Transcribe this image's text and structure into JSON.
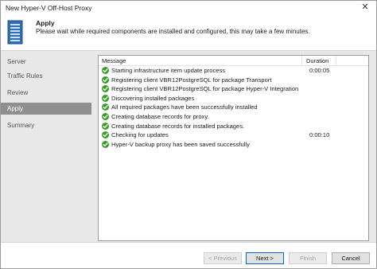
{
  "window": {
    "title": "New Hyper-V Off-Host Proxy"
  },
  "header": {
    "title": "Apply",
    "subtitle": "Please wait while required components are installed and configured, this may take a few minutes."
  },
  "sidebar": {
    "items": [
      {
        "label": "Server",
        "active": false
      },
      {
        "label": "Traffic Rules",
        "active": false
      },
      {
        "label": "Review",
        "active": false
      },
      {
        "label": "Apply",
        "active": true
      },
      {
        "label": "Summary",
        "active": false
      }
    ]
  },
  "log": {
    "columns": {
      "message": "Message",
      "duration": "Duration"
    },
    "rows": [
      {
        "status": "success",
        "message": "Starting infrastructure item update process",
        "duration": "0:00:05"
      },
      {
        "status": "success",
        "message": "Registering client VBR12PostgreSQL for package Transport",
        "duration": ""
      },
      {
        "status": "success",
        "message": "Registering client VBR12PostgreSQL for package Hyper-V Integration",
        "duration": ""
      },
      {
        "status": "success",
        "message": "Discovering installed packages",
        "duration": ""
      },
      {
        "status": "success",
        "message": "All required packages have been successfully installed",
        "duration": ""
      },
      {
        "status": "success",
        "message": "Creating database records for proxy.",
        "duration": ""
      },
      {
        "status": "success",
        "message": "Creating database records for installed packages.",
        "duration": ""
      },
      {
        "status": "success",
        "message": "Checking for updates",
        "duration": "0:00:10"
      },
      {
        "status": "success",
        "message": "Hyper-V backup proxy has been saved successfully",
        "duration": ""
      }
    ]
  },
  "footer": {
    "previous_label": "< Previous",
    "next_label": "Next >",
    "finish_label": "Finish",
    "cancel_label": "Cancel"
  },
  "colors": {
    "success": "#3a9d2a",
    "accent": "#0a64c8",
    "sidebar_active": "#8f8f8f"
  }
}
